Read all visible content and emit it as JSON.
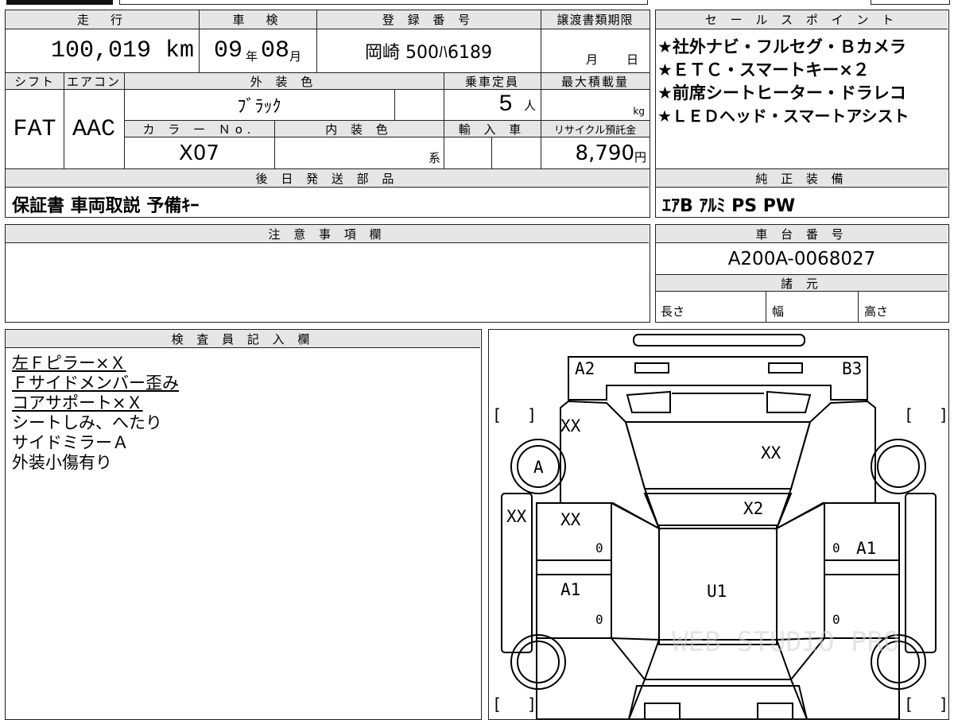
{
  "vehicle": {
    "mileage_header": "走　行",
    "mileage_value": "100,019 km",
    "inspection_header": "車　検",
    "inspection_year": "09",
    "inspection_year_unit": "年",
    "inspection_month": "08",
    "inspection_month_unit": "月",
    "registration_header": "登 録 番 号",
    "registration_value": "岡崎 500ﾊ6189",
    "transfer_header": "譲渡書類期限",
    "transfer_month_unit": "月",
    "transfer_day_unit": "日",
    "shift_header": "シフト",
    "shift_value": "FAT",
    "aircon_header": "エアコン",
    "aircon_value": "AAC",
    "exterior_color_header": "外 装 色",
    "exterior_color_value": "ﾌﾞﾗｯｸ",
    "capacity_header": "乗車定員",
    "capacity_value": "5",
    "capacity_unit": "人",
    "max_load_header": "最大積載量",
    "max_load_unit": "kg",
    "color_no_header": "カ ラ ー Ｎo.",
    "color_no_value": "X07",
    "interior_color_header": "内 装 色",
    "interior_color_suffix": "系",
    "import_header": "輸 入 車",
    "recycle_header": "リサイクル預託金",
    "recycle_value": "8,790",
    "recycle_unit": "円"
  },
  "later_parts": {
    "header": "後 日 発 送 部 品",
    "value": "保証書 車両取説 予備ｷｰ"
  },
  "notes": {
    "header": "注 意 事 項 欄"
  },
  "sales_points": {
    "header": "セ ー ル ス ポ イ ン ト",
    "items": [
      "★社外ナビ・フルセグ・Ｂカメラ",
      "★ＥＴＣ・スマートキー×２",
      "★前席シートヒーター・ドラレコ",
      "★ＬＥＤヘッド・スマートアシスト"
    ]
  },
  "genuine_equipment": {
    "header": "純 正 装 備",
    "value": "ｴｱB ｱﾙﾐ PS PW"
  },
  "chassis": {
    "header": "車 台 番 号",
    "value": "A200A-0068027"
  },
  "specs": {
    "header": "諸 元",
    "length_label": "長さ",
    "width_label": "幅",
    "height_label": "高さ"
  },
  "inspector": {
    "header": "検 査 員 記 入 欄",
    "lines": [
      "左Ｆピラー×Ｘ",
      "Ｆサイドメンバー歪み",
      "コアサポート×Ｘ",
      "シートしみ、へたり",
      "サイドミラーＡ",
      "外装小傷有り"
    ]
  },
  "diagram": {
    "marks": {
      "front_left": "A2",
      "front_right": "B3",
      "fender_left": "XX",
      "hood": "XX",
      "left_mirror": "A",
      "left_side": "XX",
      "front_door_left": "XX",
      "windshield": "X2",
      "front_door_left_zero": "0",
      "right_front_zero": "0",
      "right_front_door": "A1",
      "rear_door_left": "A1",
      "roof": "U1",
      "rear_door_left_zero": "0",
      "rear_right_zero": "0"
    },
    "bracket_open": "[",
    "bracket_close": "]",
    "watermark": "WEB STUDIO PRO"
  }
}
